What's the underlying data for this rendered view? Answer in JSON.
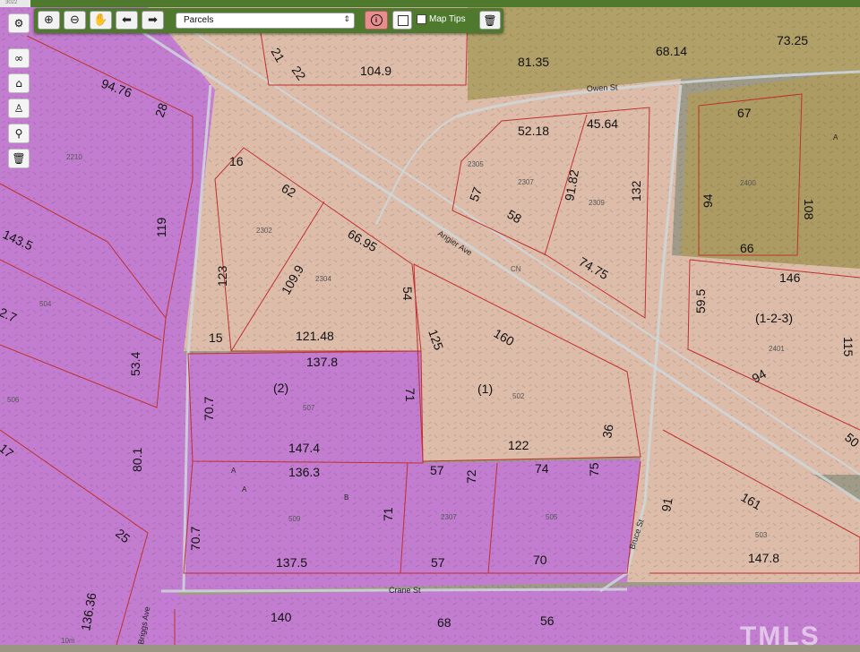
{
  "toolbar": {
    "layer_select": "Parcels",
    "map_tips_label": "Map Tips",
    "zoom_in_icon": "zoom-in-icon",
    "zoom_out_icon": "zoom-out-icon",
    "pan_icon": "hand-icon",
    "back_icon": "arrow-left-icon",
    "forward_icon": "arrow-right-icon",
    "info_icon": "info-icon",
    "trash_icon": "trash-icon"
  },
  "sidebar": [
    "gear-icon",
    "binoculars-icon",
    "home-icon",
    "person-icon",
    "map-pin-icon",
    "trash-icon"
  ],
  "corner_tag": "3022",
  "watermark": "TMLS",
  "streets": {
    "owen": "Owen St",
    "angier": "Angier Ave",
    "bruce": "Bruce St",
    "crane": "Crane St",
    "briggs": "Briggs Ave"
  },
  "colors": {
    "purple_zone": "#c47bd6",
    "peach_zone": "#e6c2b0",
    "olive_zone": "#b3a060",
    "parcel_line": "#c03030",
    "toolbar": "#4f7a2e"
  },
  "dimensions": [
    "94.76",
    "28",
    "21",
    "22",
    "104.9",
    "81.35",
    "68.14",
    "73.25",
    "119",
    "143.5",
    "2.7",
    "53.4",
    "17",
    "80.1",
    "25",
    "136.36",
    "16",
    "62",
    "123",
    "109.9",
    "66.95",
    "54",
    "15",
    "121.48",
    "137.8",
    "(2)",
    "71",
    "70.7",
    "147.4",
    "136.3",
    "57",
    "74",
    "72",
    "75",
    "70.7",
    "71",
    "137.5",
    "57",
    "70",
    "125",
    "160",
    "(1)",
    "36",
    "122",
    "57",
    "58",
    "52.18",
    "45.64",
    "91.82",
    "132",
    "74.75",
    "67",
    "94",
    "108",
    "66",
    "146",
    "59.5",
    "(1-2-3)",
    "115",
    "94",
    "50",
    "91",
    "161",
    "147.8",
    "140",
    "68",
    "56",
    "A",
    "A",
    "A",
    "B"
  ],
  "addresses": [
    "2210",
    "504",
    "506",
    "2302",
    "2304",
    "2305",
    "2307",
    "2309",
    "CN",
    "502",
    "507",
    "509",
    "2307",
    "505",
    "2400",
    "2401",
    "503",
    "10m"
  ]
}
